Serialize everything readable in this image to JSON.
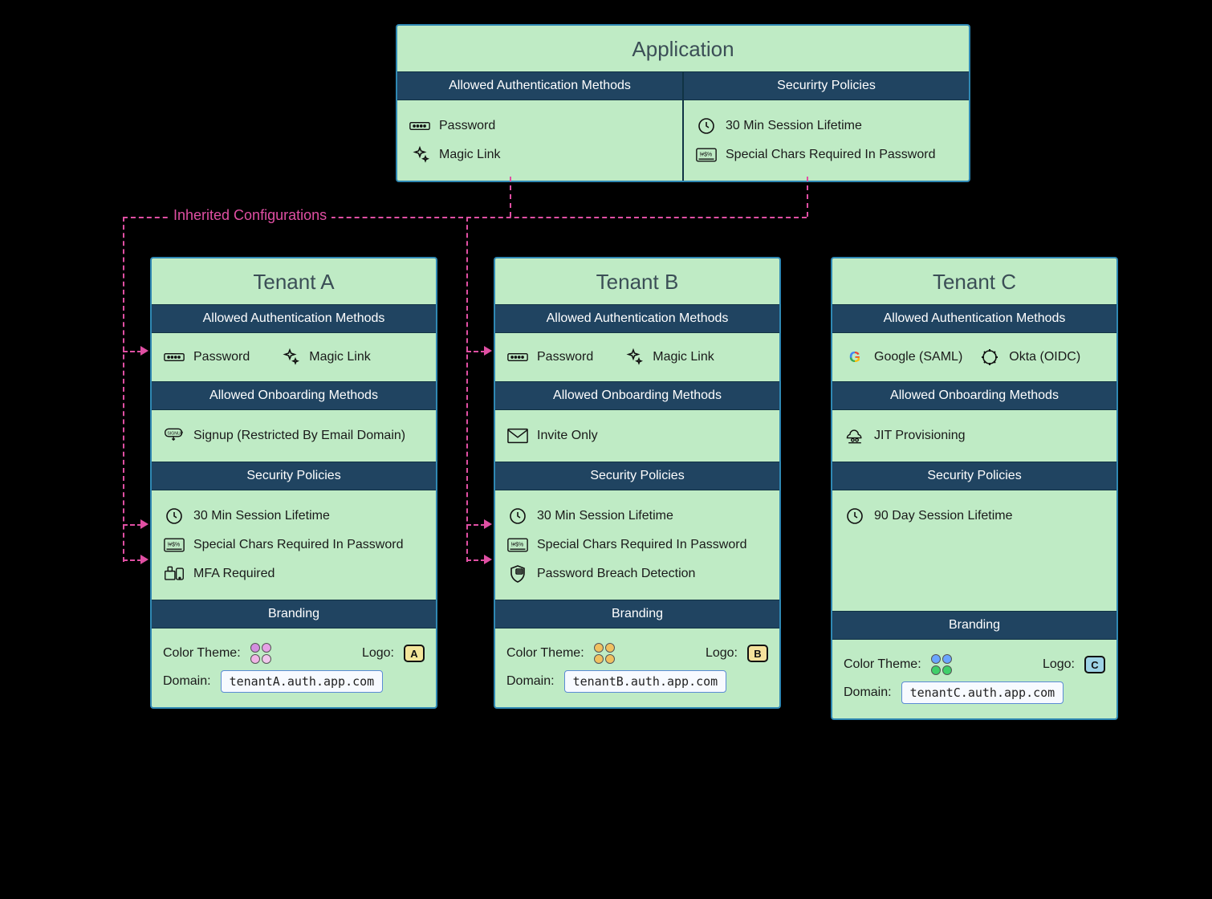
{
  "inherit_label": "Inherited Configurations",
  "application": {
    "title": "Application",
    "auth_header": "Allowed Authentication Methods",
    "sec_header": "Securirty Policies",
    "auth": {
      "password": "Password",
      "magic": "Magic Link"
    },
    "sec": {
      "session": "30 Min Session Lifetime",
      "chars": "Special Chars Required In Password"
    }
  },
  "tenants": {
    "a": {
      "title": "Tenant A",
      "auth_header": "Allowed Authentication Methods",
      "onboard_header": "Allowed Onboarding Methods",
      "sec_header": "Security Policies",
      "brand_header": "Branding",
      "auth": {
        "password": "Password",
        "magic": "Magic Link"
      },
      "onboard": {
        "signup": "Signup (Restricted By Email Domain)"
      },
      "sec": {
        "session": "30 Min Session Lifetime",
        "chars": "Special Chars Required In Password",
        "mfa": "MFA Required"
      },
      "brand": {
        "theme_label": "Color Theme:",
        "logo_label": "Logo:",
        "logo_letter": "A",
        "domain_label": "Domain:",
        "domain_value": "tenantA.auth.app.com",
        "swatches": [
          "#d38fe0",
          "#e6a1e6",
          "#f0b5e6",
          "#f0c7ec"
        ]
      }
    },
    "b": {
      "title": "Tenant B",
      "auth_header": "Allowed Authentication Methods",
      "onboard_header": "Allowed Onboarding Methods",
      "sec_header": "Security Policies",
      "brand_header": "Branding",
      "auth": {
        "password": "Password",
        "magic": "Magic Link"
      },
      "onboard": {
        "invite": "Invite Only"
      },
      "sec": {
        "session": "30 Min Session Lifetime",
        "chars": "Special Chars Required In Password",
        "breach": "Password Breach Detection"
      },
      "brand": {
        "theme_label": "Color Theme:",
        "logo_label": "Logo:",
        "logo_letter": "B",
        "domain_label": "Domain:",
        "domain_value": "tenantB.auth.app.com",
        "swatches": [
          "#f0c060",
          "#f0c060",
          "#f0c060",
          "#f0c060"
        ]
      }
    },
    "c": {
      "title": "Tenant C",
      "auth_header": "Allowed Authentication Methods",
      "onboard_header": "Allowed Onboarding Methods",
      "sec_header": "Security Policies",
      "brand_header": "Branding",
      "auth": {
        "google": "Google (SAML)",
        "okta": "Okta (OIDC)"
      },
      "onboard": {
        "jit": "JIT Provisioning"
      },
      "sec": {
        "session": "90 Day Session Lifetime"
      },
      "brand": {
        "theme_label": "Color Theme:",
        "logo_label": "Logo:",
        "logo_letter": "C",
        "domain_label": "Domain:",
        "domain_value": "tenantC.auth.app.com",
        "swatches": [
          "#6aa5ff",
          "#6aa5ff",
          "#3fcf6a",
          "#3fcf6a"
        ]
      }
    }
  }
}
